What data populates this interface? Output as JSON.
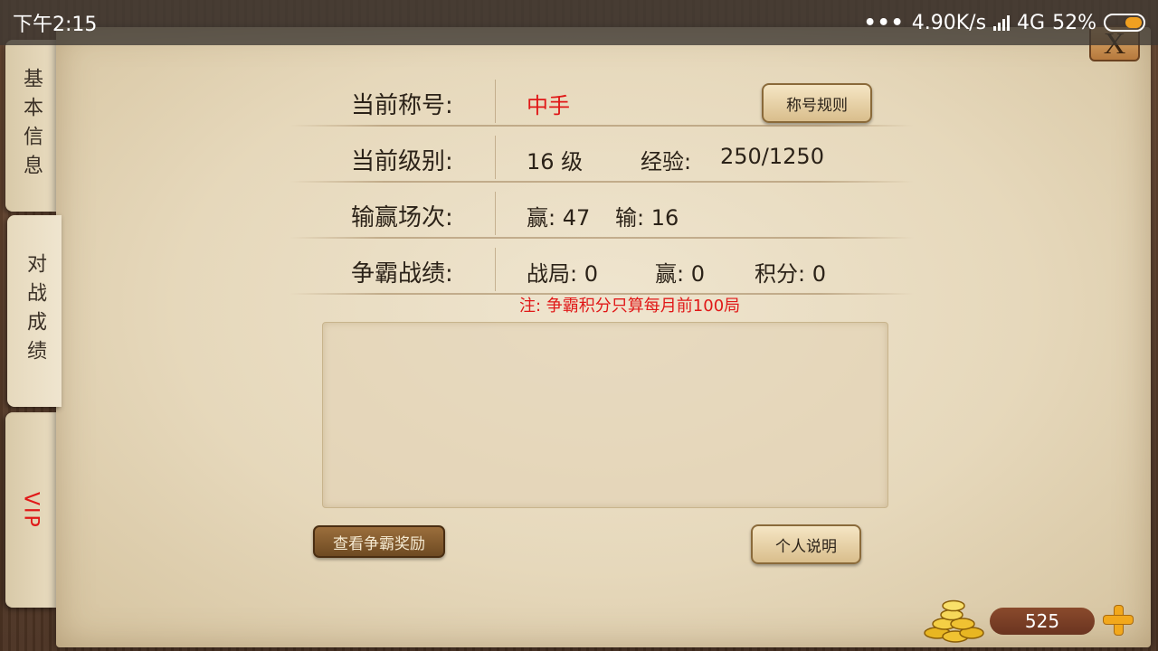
{
  "status_bar": {
    "time": "下午2:15",
    "network_speed": "4.90K/s",
    "network_type": "4G",
    "battery": "52%"
  },
  "close_button": {
    "label": "X"
  },
  "side_tabs": [
    {
      "label": "基本信息",
      "active": false
    },
    {
      "label": "对战成绩",
      "active": true
    },
    {
      "label": "VIP",
      "active": false
    }
  ],
  "profile": {
    "title_label": "当前称号:",
    "title_value": "中手",
    "title_rules_button": "称号规则",
    "level_label": "当前级别:",
    "level_value": "16 级",
    "exp_label": "经验:",
    "exp_value": "250/1250",
    "record_label": "输赢场次:",
    "wins_text": "赢: 47",
    "losses_text": "输: 16",
    "compete_label": "争霸战绩:",
    "compete_games": "战局: 0",
    "compete_wins": "赢: 0",
    "compete_points": "积分: 0",
    "note": "注: 争霸积分只算每月前100局"
  },
  "buttons": {
    "view_rewards": "查看争霸奖励",
    "personal_desc": "个人说明"
  },
  "coins": {
    "amount": "525"
  },
  "colors": {
    "highlight_red": "#e01818",
    "parchment": "#e6d8bb",
    "wood": "#4a3222"
  }
}
